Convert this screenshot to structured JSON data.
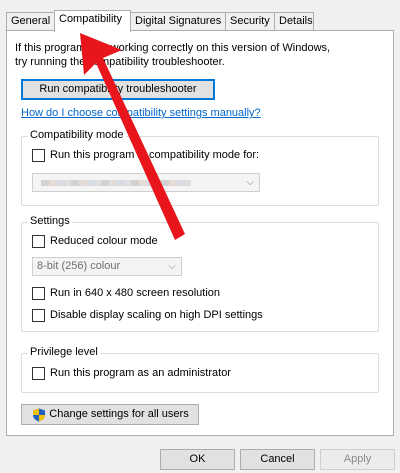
{
  "tabs": [
    {
      "label": "General"
    },
    {
      "label": "Compatibility"
    },
    {
      "label": "Digital Signatures"
    },
    {
      "label": "Security"
    },
    {
      "label": "Details"
    }
  ],
  "intro": {
    "line1": "If this program isn't working correctly on this version of Windows,",
    "line2": "try running the compatibility troubleshooter."
  },
  "troubleshooter_button": "Run compatibility troubleshooter",
  "help_link": "How do I choose compatibility settings manually?",
  "compat_mode": {
    "title": "Compatibility mode",
    "checkbox_label": "Run this program in compatibility mode for:"
  },
  "settings": {
    "title": "Settings",
    "reduced_colour_label": "Reduced colour mode",
    "colour_select_value": "8-bit (256) colour",
    "resolution_label": "Run in 640 x 480 screen resolution",
    "dpi_label": "Disable display scaling on high DPI settings"
  },
  "privilege": {
    "title": "Privilege level",
    "admin_label": "Run this program as an administrator"
  },
  "change_all_button": "Change settings for all users",
  "footer": {
    "ok": "OK",
    "cancel": "Cancel",
    "apply": "Apply"
  },
  "colors": {
    "annotation_arrow": "#e8161c",
    "link": "#0066cc",
    "focus_border": "#0078d7"
  }
}
